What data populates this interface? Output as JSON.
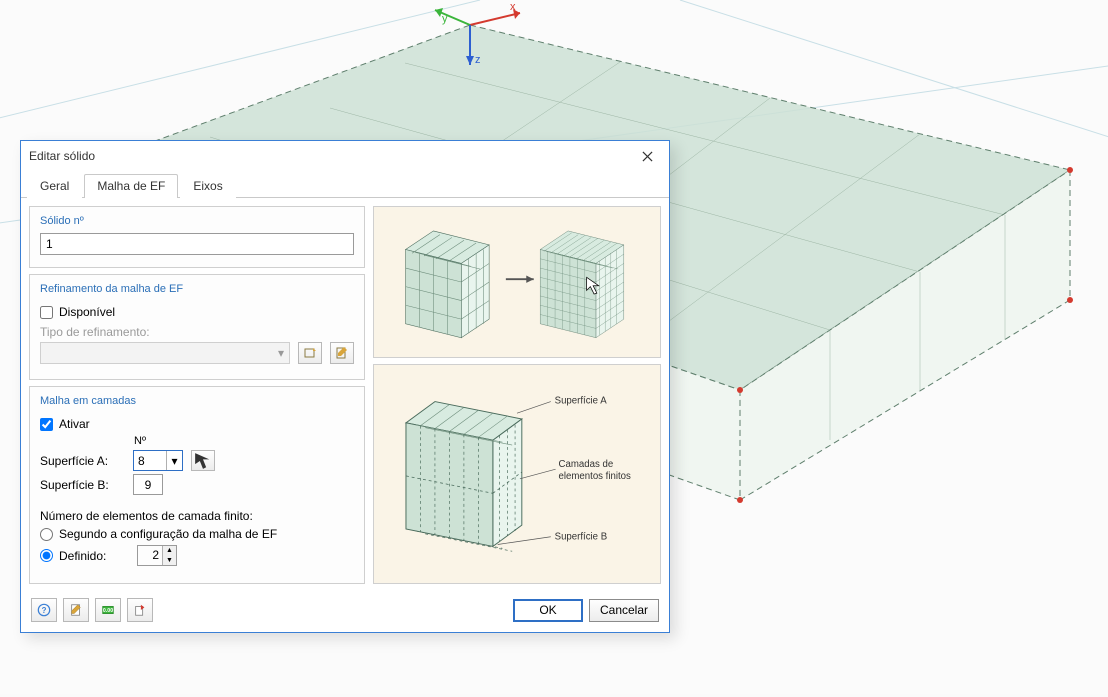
{
  "dialog": {
    "title": "Editar sólido",
    "tabs": [
      {
        "label": "Geral"
      },
      {
        "label": "Malha de EF"
      },
      {
        "label": "Eixos"
      }
    ],
    "active_tab": 1,
    "solid_group": {
      "title": "Sólido nº",
      "value": "1"
    },
    "refinement_group": {
      "title": "Refinamento da malha de EF",
      "available_label": "Disponível",
      "available_checked": false,
      "type_label": "Tipo de refinamento:"
    },
    "layered_group": {
      "title": "Malha em camadas",
      "activate_label": "Ativar",
      "activate_checked": true,
      "number_header": "Nº",
      "surface_a_label": "Superfície A:",
      "surface_a_value": "8",
      "surface_b_label": "Superfície B:",
      "surface_b_value": "9",
      "count_label": "Número de elementos de camada finito:",
      "radio_auto_label": "Segundo a configuração da malha de EF",
      "radio_defined_label": "Definido:",
      "defined_value": "2",
      "selected_radio": "defined"
    },
    "diagram": {
      "surface_a": "Superfície A",
      "layers_text1": "Camadas de",
      "layers_text2": "elementos finitos",
      "surface_b": "Superfície B"
    },
    "buttons": {
      "ok": "OK",
      "cancel": "Cancelar"
    }
  },
  "axes": {
    "x": "x",
    "y": "y",
    "z": "z"
  }
}
